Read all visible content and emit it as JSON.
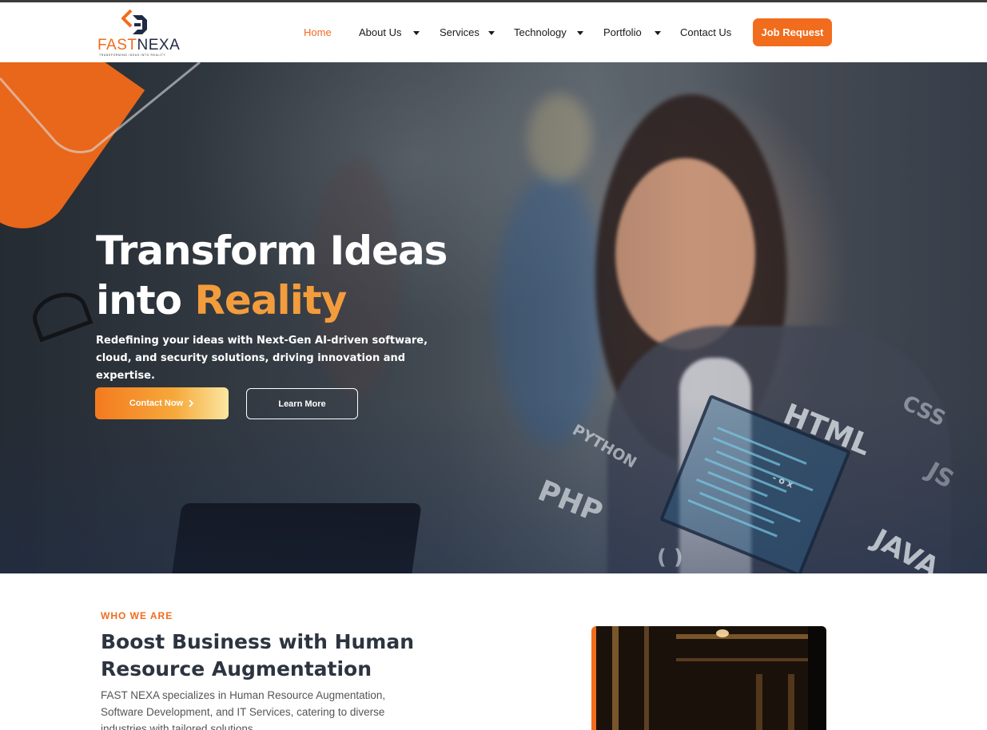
{
  "header": {
    "logo": {
      "brand_part1": "FAST",
      "brand_part2": "NEXA",
      "tagline": "TRANSFORMING IDEAS INTO REALITY"
    },
    "nav": [
      {
        "label": "Home",
        "active": true,
        "dropdown": false
      },
      {
        "label": "About Us",
        "active": false,
        "dropdown": true
      },
      {
        "label": "Services",
        "active": false,
        "dropdown": true
      },
      {
        "label": "Technology",
        "active": false,
        "dropdown": true
      },
      {
        "label": "Portfolio",
        "active": false,
        "dropdown": true
      },
      {
        "label": "Contact Us",
        "active": false,
        "dropdown": false
      }
    ],
    "cta_label": "Job Request"
  },
  "hero": {
    "title_line1": "Transform Ideas",
    "title_line2_plain": "into ",
    "title_line2_accent": "Reality",
    "subtitle": "Redefining your ideas with Next-Gen AI-driven software, cloud, and security solutions, driving innovation and expertise.",
    "contact_button": "Contact Now",
    "contact_button_icon": "chevron-right-icon",
    "learn_button": "Learn More",
    "code_words": [
      "HTML",
      "CSS",
      "JS",
      "PYTHON",
      "PHP",
      "JAVA",
      "( )",
      "- o x"
    ]
  },
  "who": {
    "label": "WHO WE ARE",
    "title": "Boost Business with Human Resource Augmentation",
    "text": "FAST NEXA specializes in Human Resource Augmentation, Software Development, and IT Services, catering to diverse industries with tailored solutions."
  },
  "colors": {
    "accent": "#f26c1d",
    "accent_light": "#f39c3c",
    "heading": "#2c3440"
  }
}
